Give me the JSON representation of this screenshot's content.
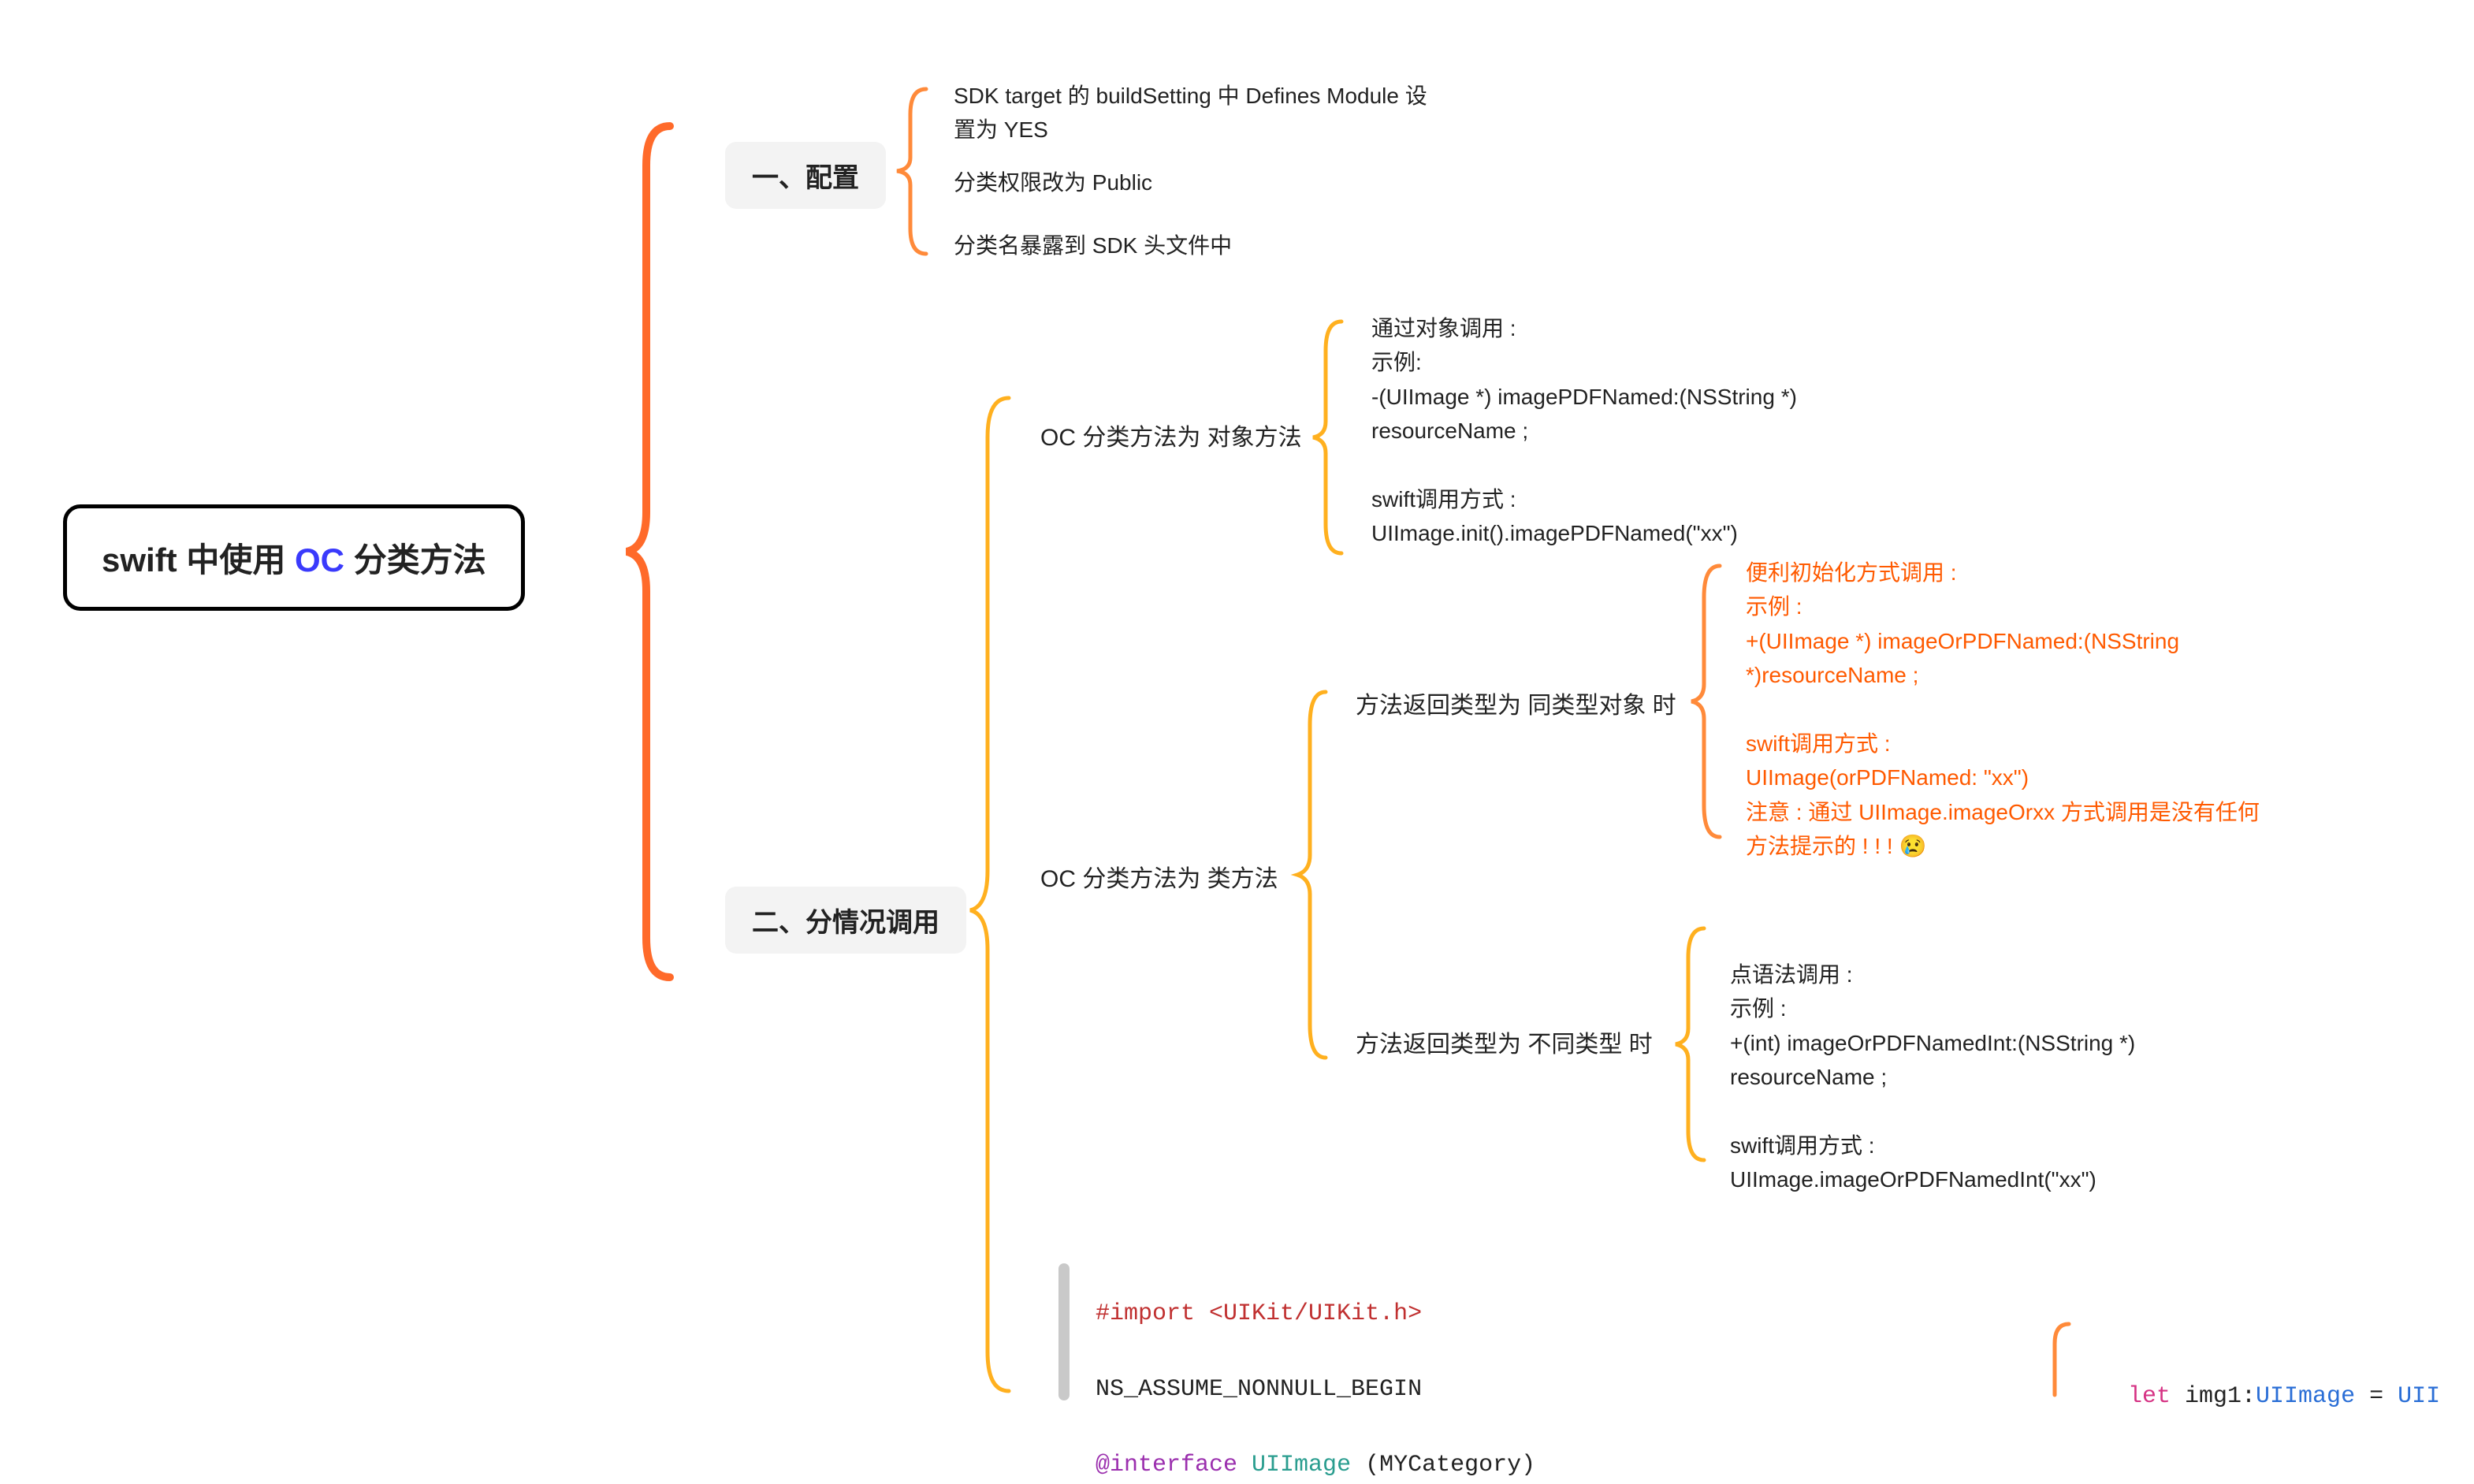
{
  "root": {
    "prefix": "swift ",
    "mid": "中使用 ",
    "bold": "OC ",
    "suffix": "分类方法"
  },
  "section1": {
    "title": "一、配置",
    "items": [
      "SDK target 的 buildSetting 中 Defines Module 设置为 YES",
      "分类权限改为 Public",
      "分类名暴露到 SDK 头文件中"
    ]
  },
  "section2": {
    "title": "二、分情况调用",
    "branch1": {
      "title": "OC 分类方法为 对象方法",
      "leaf": "通过对象调用 :\n示例:\n-(UIImage *) imagePDFNamed:(NSString *) resourceName ;\n\nswift调用方式 :\n   UIImage.init().imagePDFNamed(\"xx\")"
    },
    "branch2": {
      "title": "OC 分类方法为 类方法",
      "sub1": {
        "title": "方法返回类型为 同类型对象 时",
        "leaf": "便利初始化方式调用 :\n示例 :\n +(UIImage *) imageOrPDFNamed:(NSString *)resourceName ;\n\nswift调用方式 :\n     UIImage(orPDFNamed: \"xx\")\n注意 : 通过 UIImage.imageOrxx 方式调用是没有任何方法提示的 !  !  ! 😢"
      },
      "sub2": {
        "title": "方法返回类型为 不同类型 时",
        "leaf": "点语法调用 :\n示例 :\n   +(int) imageOrPDFNamedInt:(NSString *) resourceName ;\n\nswift调用方式 :\n   UIImage.imageOrPDFNamedInt(\"xx\")"
      }
    }
  },
  "code_left": {
    "l1_a": "#import ",
    "l1_b": "<UIKit/UIKit.h>",
    "l2": "NS_ASSUME_NONNULL_BEGIN",
    "l3_a": "@interface ",
    "l3_b": "UIImage ",
    "l3_c": "(MYCategory)"
  },
  "code_right": {
    "l1_a": "let",
    "l1_b": " img1:",
    "l1_c": "UIImage",
    "l1_d": " = ",
    "l1_e": "UII"
  }
}
